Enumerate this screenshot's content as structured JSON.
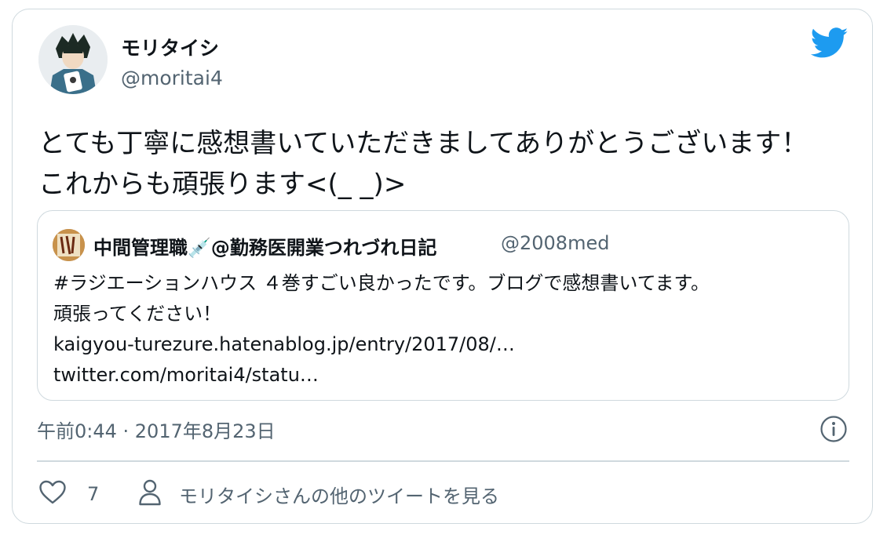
{
  "author": {
    "display_name": "モリタイシ",
    "handle": "@moritai4"
  },
  "tweet": {
    "lines": [
      "とても丁寧に感想書いていただきましてありがとうございます！",
      "これからも頑張ります<(_ _)>"
    ]
  },
  "quoted_tweet": {
    "display_name": "中間管理職💉@勤務医開業つれづれ日記",
    "handle": "@2008med",
    "lines": [
      "#ラジエーションハウス ４巻すごい良かったです。ブログで感想書いてます。",
      "頑張ってください！",
      "kaigyou-turezure.hatenablog.jp/entry/2017/08/…",
      "twitter.com/moritai4/statu…"
    ]
  },
  "meta": {
    "timestamp": "午前0:44 · 2017年8月23日"
  },
  "actions": {
    "like_count": "7",
    "more_tweets_label": "モリタイシさんの他のツイートを見る"
  },
  "colors": {
    "brand": "#1d9bf0",
    "secondary_text": "#536471",
    "border": "#cfd9de"
  },
  "icons": [
    "twitter-bird-icon",
    "info-icon",
    "heart-icon",
    "person-icon"
  ]
}
